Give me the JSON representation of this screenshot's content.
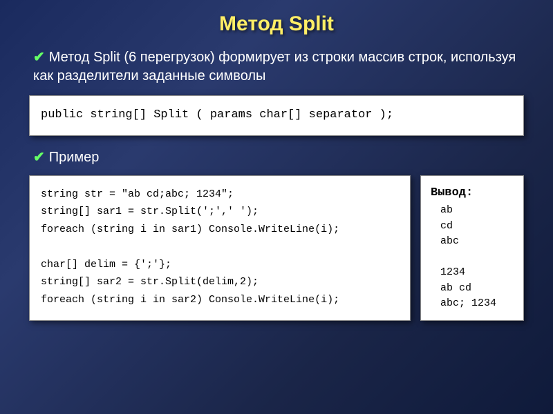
{
  "title": "Метод Split",
  "description": "Метод Split (6 перегрузок) формирует из строки массив строк, используя как разделители заданные символы",
  "signature": "public string[] Split ( params char[] separator );",
  "example_label": "Пример",
  "example_code": "string str = \"ab cd;abc; 1234\";\nstring[] sar1 = str.Split(';',' ');\nforeach (string i in sar1) Console.WriteLine(i);\n\nchar[] delim = {';'};\nstring[] sar2 = str.Split(delim,2);\nforeach (string i in sar2) Console.WriteLine(i);",
  "output": {
    "title": "Вывод:",
    "lines": "ab\ncd\nabc\n\n1234\nab cd\nabc; 1234"
  }
}
